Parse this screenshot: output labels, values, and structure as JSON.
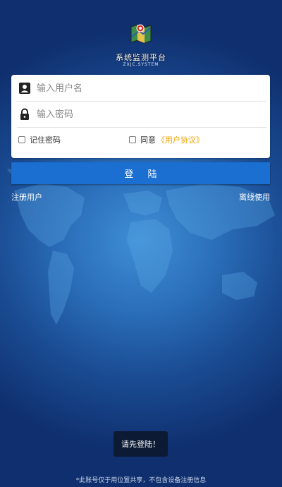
{
  "app": {
    "name": "系统监测平台",
    "subtitle": "ZXJC.SYSTEM"
  },
  "login_form": {
    "username_placeholder": "输入用户名",
    "username_value": "",
    "password_placeholder": "输入密码",
    "password_value": "",
    "remember_label": "记住密码",
    "remember_checked": false,
    "agree_label": "同意",
    "agreement_link": "《用户协议》",
    "agree_checked": false,
    "login_button": "登 陆"
  },
  "links": {
    "register": "注册用户",
    "offline": "离线使用"
  },
  "toast": {
    "message": "请先登陆！"
  },
  "footer": {
    "note": "*此账号仅于用位置共享，不包含设备注册信息"
  },
  "colors": {
    "primary_button": "#1a6fd1",
    "agreement_link": "#f2a300",
    "background_dark": "#0f2f6e",
    "background_light": "#3f8fd6"
  },
  "icons": {
    "logo": "map-pin-logo-icon",
    "username": "user-card-icon",
    "password": "lock-icon"
  }
}
